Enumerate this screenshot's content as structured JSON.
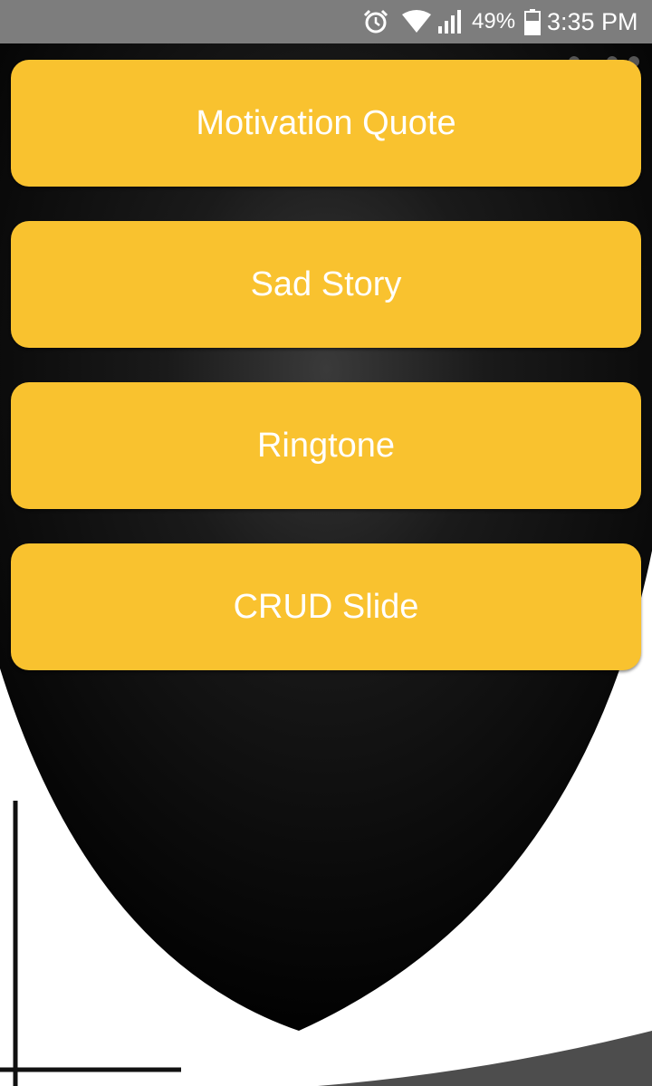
{
  "status_bar": {
    "battery_percent": "49%",
    "time": "3:35 PM",
    "icons": [
      "alarm-icon",
      "wifi-icon",
      "signal-icon",
      "battery-icon"
    ]
  },
  "menu": {
    "buttons": [
      {
        "label": "Motivation Quote"
      },
      {
        "label": "Sad Story"
      },
      {
        "label": "Ringtone"
      },
      {
        "label": "CRUD Slide"
      }
    ]
  },
  "colors": {
    "button": "#f9c22f",
    "button_text": "#ffffff",
    "status_bar": "#7d7d7d",
    "background": "#4d4d4d"
  }
}
